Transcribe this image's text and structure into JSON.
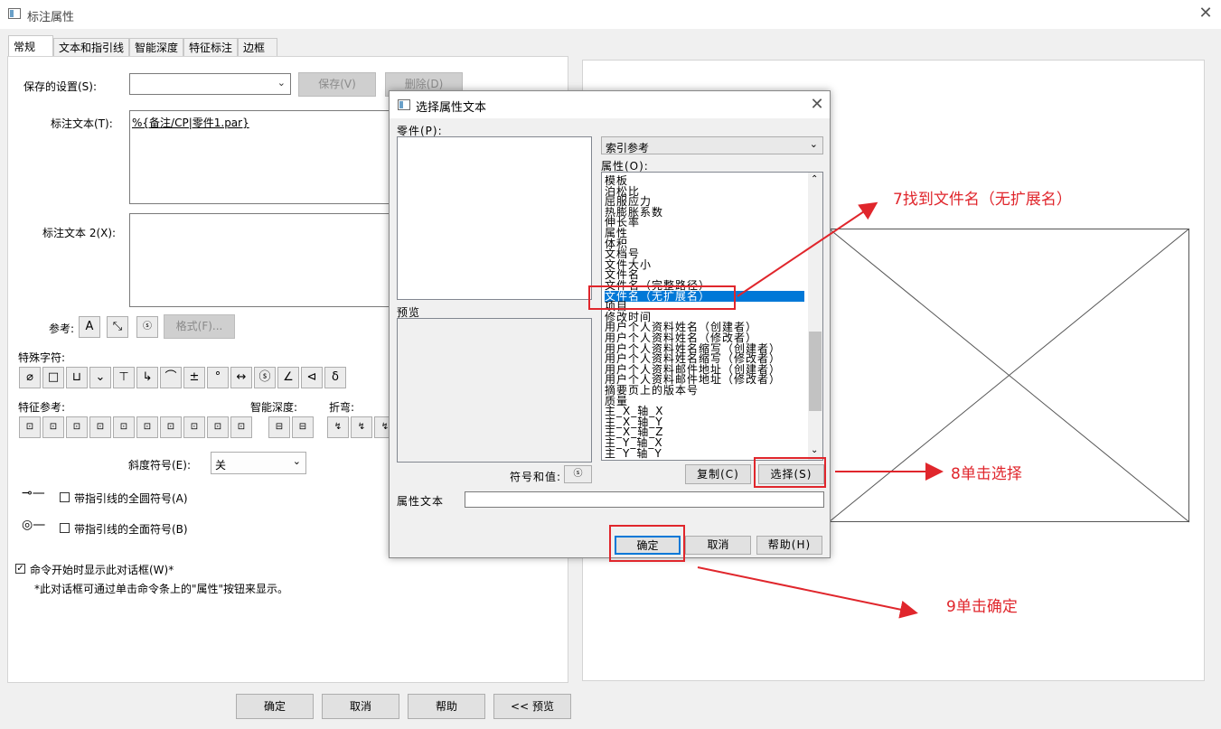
{
  "window": {
    "title": "标注属性"
  },
  "tabs": [
    "常规",
    "文本和指引线",
    "智能深度",
    "特征标注",
    "边框"
  ],
  "general": {
    "saved_settings_label": "保存的设置(S):",
    "save_button": "保存(V)",
    "delete_button": "删除(D)",
    "callout_text_label": "标注文本(T):",
    "callout_text_value": "%{备注/CP|零件1.par}",
    "callout_text2_label": "标注文本 2(X):",
    "reference_label": "参考:",
    "format_button": "格式(F)...",
    "special_chars_label": "特殊字符:",
    "special_chars": [
      "⌀",
      "□",
      "⊔",
      "⌄",
      "⊤",
      "↳",
      "⌒",
      "±",
      "°",
      "↔",
      "ⓢ",
      "∠",
      "⊲",
      "δ"
    ],
    "feature_ref_label": "特征参考:",
    "smart_depth_label": "智能深度:",
    "fold_label": "折弯:",
    "slope_label": "斜度符号(E):",
    "slope_value": "关",
    "all_around_label": "带指引线的全圆符号(A)",
    "all_over_label": "带指引线的全面符号(B)",
    "show_dialog_label": "命令开始时显示此对话框(W)*",
    "footnote": "*此对话框可通过单击命令条上的\"属性\"按钮来显示。"
  },
  "preview_label": "预览",
  "bottom_buttons": {
    "ok": "确定",
    "cancel": "取消",
    "help": "帮助",
    "preview": "<< 预览"
  },
  "modal": {
    "title": "选择属性文本",
    "part_label": "零件(P):",
    "ref_dropdown": "索引参考",
    "attr_label": "属性(O):",
    "preview_label": "预览",
    "symbol_value_label": "符号和值:",
    "copy_button": "复制(C)",
    "select_button": "选择(S)",
    "attr_text_label": "属性文本",
    "ok_button": "确定",
    "cancel_button": "取消",
    "help_button": "帮助(H)",
    "attributes": [
      "模板",
      "泊松比",
      "屈服应力",
      "热膨胀系数",
      "伸长率",
      "属性",
      "体积",
      "文档号",
      "文件大小",
      "文件名",
      "文件名（完整路径）",
      "文件名（无扩展名）",
      "项目",
      "修改时间",
      "用户个人资料姓名（创建者）",
      "用户个人资料姓名（修改者）",
      "用户个人资料姓名缩写（创建者）",
      "用户个人资料姓名缩写（修改者）",
      "用户个人资料邮件地址（创建者）",
      "用户个人资料邮件地址（修改者）",
      "摘要页上的版本号",
      "质量",
      "主_X_轴_X",
      "主_X_轴_Y",
      "主_X_轴_Z",
      "主_Y_轴_X",
      "主_Y_轴_Y"
    ],
    "selected_index": 11
  },
  "annotations": {
    "step7": "7找到文件名（无扩展名）",
    "step8": "8单击选择",
    "step9": "9单击确定"
  },
  "colors": {
    "selection": "#0078d7",
    "annotation": "#e0262c"
  }
}
